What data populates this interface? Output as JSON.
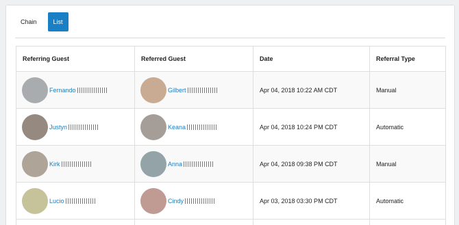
{
  "tabs": [
    {
      "label": "Chain",
      "active": false
    },
    {
      "label": "List",
      "active": true
    }
  ],
  "colors": {
    "accent": "#1b7fc6",
    "link": "#1f7dbb"
  },
  "table": {
    "headers": [
      "Referring Guest",
      "Referred Guest",
      "Date",
      "Referral Type"
    ],
    "rows": [
      {
        "referring": {
          "name": "Fernando",
          "avatar_color": "#a9acae"
        },
        "referred": {
          "name": "Gilbert",
          "avatar_color": "#c8ab92"
        },
        "date": "Apr 04, 2018 10:22 AM CDT",
        "type": "Manual"
      },
      {
        "referring": {
          "name": "Justyn",
          "avatar_color": "#968a80"
        },
        "referred": {
          "name": "Keana",
          "avatar_color": "#a59e98"
        },
        "date": "Apr 04, 2018 10:24 PM CDT",
        "type": "Automatic"
      },
      {
        "referring": {
          "name": "Kirk",
          "avatar_color": "#afa498"
        },
        "referred": {
          "name": "Anna",
          "avatar_color": "#94a3a8"
        },
        "date": "Apr 04, 2018 09:38 PM CDT",
        "type": "Manual"
      },
      {
        "referring": {
          "name": "Lucio",
          "avatar_color": "#c6c29a"
        },
        "referred": {
          "name": "Cindy",
          "avatar_color": "#bf9b93"
        },
        "date": "Apr 03, 2018 03:30 PM CDT",
        "type": "Automatic"
      }
    ]
  }
}
